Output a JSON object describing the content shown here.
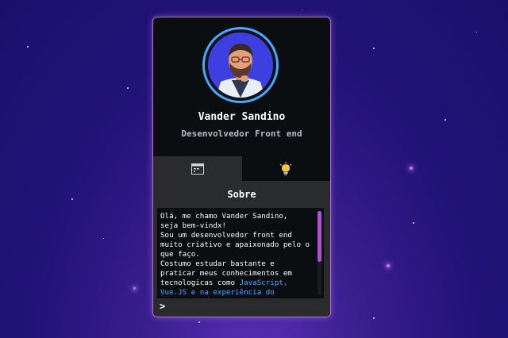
{
  "profile": {
    "name": "Vander Sandino",
    "role": "Desenvolvedor Front end"
  },
  "tabs": [
    {
      "icon": "code-window-icon",
      "active": true
    },
    {
      "icon": "lightbulb-icon",
      "active": false
    }
  ],
  "about": {
    "title": "Sobre",
    "paragraph_lines": [
      "Olá, me chamo Vander Sandino,",
      "seja bem-vindx!",
      "Sou um desenvolvedor front end",
      "muito criativo e apaixonado pelo o",
      "que faço.",
      "Costumo estudar bastante e",
      "praticar meus conhecimentos em",
      "tecnologicas como "
    ],
    "highlight_1": "JavaScript,",
    "highlight_2": "Vue.JS e na experiência do",
    "more_indicator": ">",
    "scroll_fraction": 0.6
  },
  "colors": {
    "accent": "#b66bd9",
    "link": "#4aa6ff",
    "scroll": "#b24fd6"
  }
}
